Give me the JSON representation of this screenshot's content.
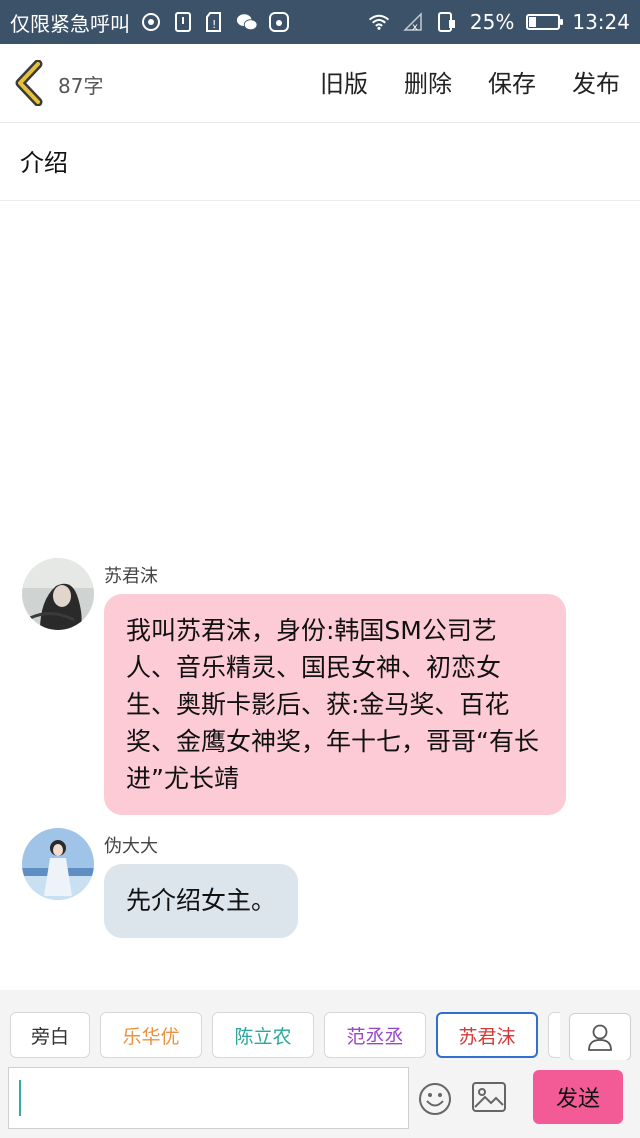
{
  "status_bar": {
    "carrier": "仅限紧急呼叫",
    "battery_percent": "25%",
    "time": "13:24",
    "battery_level": 0.25,
    "icons": [
      "hotspot-icon",
      "sim-icon",
      "sd-warning-icon",
      "wechat-icon",
      "app-icon",
      "wifi-icon",
      "no-signal-icon",
      "sim-card-icon",
      "battery-icon"
    ]
  },
  "header": {
    "word_count": "87字",
    "actions": [
      "旧版",
      "删除",
      "保存",
      "发布"
    ]
  },
  "title": "介绍",
  "messages": [
    {
      "sender": "苏君沫",
      "text": "我叫苏君沫，身份:韩国SM公司艺人、音乐精灵、国民女神、初恋女生、奥斯卡影后、获:金马奖、百花奖、金鹰女神奖，年十七，哥哥“有长进”尤长靖",
      "bubble_color": "#fdcbd6"
    },
    {
      "sender": "伪大大",
      "text": "先介绍女主。",
      "bubble_color": "#dce4ec"
    }
  ],
  "roles": [
    {
      "label": "旁白",
      "color": "#333333"
    },
    {
      "label": "乐华优",
      "color": "#f0903a"
    },
    {
      "label": "陈立农",
      "color": "#2aa89a"
    },
    {
      "label": "范丞丞",
      "color": "#9b45c8"
    },
    {
      "label": "苏君沫",
      "color": "#d43a3a",
      "selected": true
    }
  ],
  "input": {
    "send_label": "发送",
    "send_color": "#f25b96"
  }
}
